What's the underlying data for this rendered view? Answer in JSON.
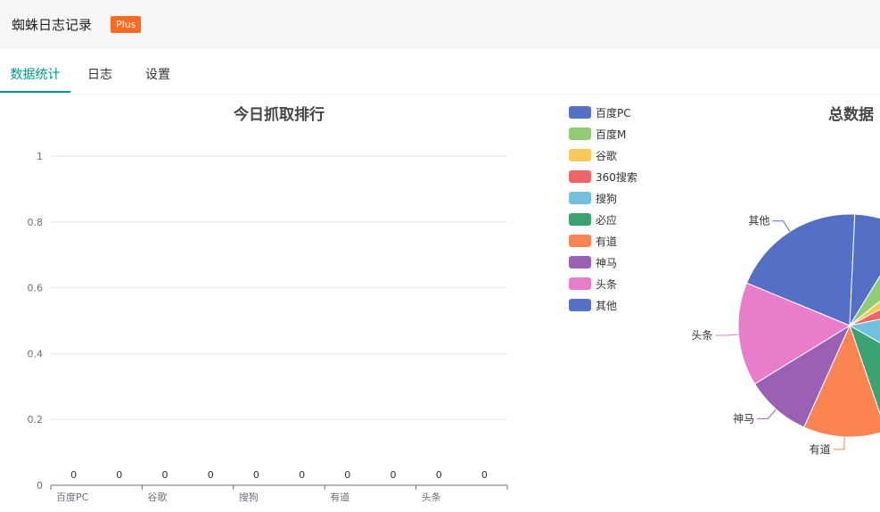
{
  "app": {
    "title": "蜘蛛日志记录",
    "badge": "Plus"
  },
  "tabs": [
    {
      "label": "数据统计",
      "active": true
    },
    {
      "label": "日志",
      "active": false
    },
    {
      "label": "设置",
      "active": false
    }
  ],
  "colors": {
    "accent": "#009688",
    "badge": "#f76b25",
    "series": [
      "#5470c6",
      "#91cc75",
      "#fac858",
      "#ee6666",
      "#73c0de",
      "#3ba272",
      "#fc8452",
      "#9a60b4",
      "#ea7ccc",
      "#5470c6"
    ]
  },
  "chart_data": [
    {
      "type": "bar",
      "title": "今日抓取排行",
      "categories": [
        "百度PC",
        "百度M",
        "谷歌",
        "360搜索",
        "搜狗",
        "必应",
        "有道",
        "神马",
        "头条",
        "其他"
      ],
      "visible_tick_labels": [
        "百度PC",
        "谷歌",
        "搜狗",
        "有道",
        "头条"
      ],
      "values": [
        0,
        0,
        0,
        0,
        0,
        0,
        0,
        0,
        0,
        0
      ],
      "ylim": [
        0,
        1
      ],
      "yticks": [
        "0",
        "0.2",
        "0.4",
        "0.6",
        "0.8",
        "1"
      ],
      "grid": true
    },
    {
      "type": "pie",
      "title": "总数据",
      "legend": [
        "百度PC",
        "百度M",
        "谷歌",
        "360搜索",
        "搜狗",
        "必应",
        "有道",
        "神马",
        "头条",
        "其他"
      ],
      "legend_position": "left",
      "slices": [
        {
          "name": "其他",
          "value": 0.195
        },
        {
          "name": "百度PC",
          "value": 0.08
        },
        {
          "name": "百度M",
          "value": 0.055
        },
        {
          "name": "谷歌",
          "value": 0.03
        },
        {
          "name": "360搜索",
          "value": 0.045
        },
        {
          "name": "搜狗",
          "value": 0.115
        },
        {
          "name": "必应",
          "value": 0.115
        },
        {
          "name": "有道",
          "value": 0.12
        },
        {
          "name": "神马",
          "value": 0.095
        },
        {
          "name": "头条",
          "value": 0.15
        }
      ],
      "labelled_slices": [
        "其他",
        "头条",
        "神马",
        "有道",
        "必应"
      ]
    }
  ]
}
